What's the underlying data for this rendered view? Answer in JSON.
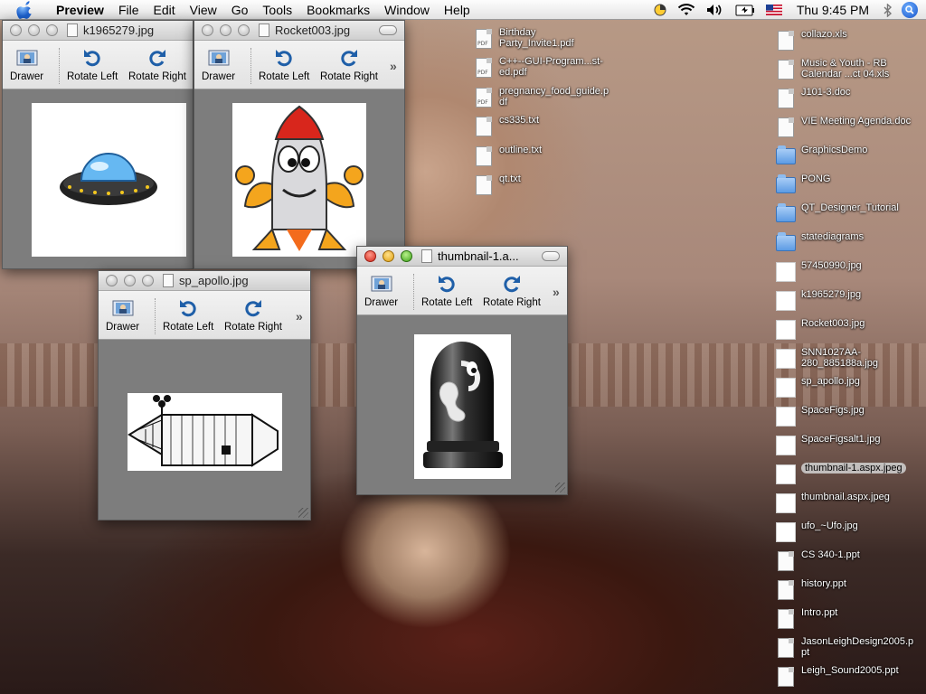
{
  "menubar": {
    "app_name": "Preview",
    "items": [
      "File",
      "Edit",
      "View",
      "Go",
      "Tools",
      "Bookmarks",
      "Window",
      "Help"
    ],
    "clock": "Thu 9:45 PM"
  },
  "toolbar_labels": {
    "drawer": "Drawer",
    "rotate_left": "Rotate Left",
    "rotate_right": "Rotate Right"
  },
  "windows": {
    "ufo": {
      "title": "k1965279.jpg"
    },
    "rocket": {
      "title": "Rocket003.jpg"
    },
    "apollo": {
      "title": "sp_apollo.jpg"
    },
    "bullet": {
      "title": "thumbnail-1.a..."
    }
  },
  "desktop_center": [
    {
      "name": "Birthday Party_Invite1.pdf",
      "kind": "pdf"
    },
    {
      "name": "C++--GUI-Program...st-ed.pdf",
      "kind": "pdf"
    },
    {
      "name": "pregnancy_food_guide.pdf",
      "kind": "pdf"
    },
    {
      "name": "cs335.txt",
      "kind": "txt"
    },
    {
      "name": "outline.txt",
      "kind": "txt"
    },
    {
      "name": "qt.txt",
      "kind": "txt"
    }
  ],
  "desktop_right": [
    {
      "name": "collazo.xls",
      "kind": "file"
    },
    {
      "name": "Music & Youth - RB Calendar ...ct 04.xls",
      "kind": "file"
    },
    {
      "name": "J101-3.doc",
      "kind": "file"
    },
    {
      "name": "VIE Meeting Agenda.doc",
      "kind": "file"
    },
    {
      "name": "GraphicsDemo",
      "kind": "folder"
    },
    {
      "name": "PONG",
      "kind": "folder"
    },
    {
      "name": "QT_Designer_Tutorial",
      "kind": "folder"
    },
    {
      "name": "statediagrams",
      "kind": "folder"
    },
    {
      "name": "57450990.jpg",
      "kind": "image"
    },
    {
      "name": "k1965279.jpg",
      "kind": "image"
    },
    {
      "name": "Rocket003.jpg",
      "kind": "image"
    },
    {
      "name": "SNN1027AA-280_885188a.jpg",
      "kind": "image"
    },
    {
      "name": "sp_apollo.jpg",
      "kind": "image"
    },
    {
      "name": "SpaceFigs.jpg",
      "kind": "image"
    },
    {
      "name": "SpaceFigsalt1.jpg",
      "kind": "image"
    },
    {
      "name": "thumbnail-1.aspx.jpeg",
      "kind": "image",
      "selected": true
    },
    {
      "name": "thumbnail.aspx.jpeg",
      "kind": "image"
    },
    {
      "name": "ufo_~Ufo.jpg",
      "kind": "image"
    },
    {
      "name": "CS 340-1.ppt",
      "kind": "file"
    },
    {
      "name": "history.ppt",
      "kind": "file"
    },
    {
      "name": "Intro.ppt",
      "kind": "file"
    },
    {
      "name": "JasonLeighDesign2005.ppt",
      "kind": "file"
    },
    {
      "name": "Leigh_Sound2005.ppt",
      "kind": "file"
    }
  ],
  "icons": {
    "apple": "apple-icon",
    "rotate_left": "rotate-left-icon",
    "rotate_right": "rotate-right-icon",
    "drawer": "drawer-icon"
  }
}
